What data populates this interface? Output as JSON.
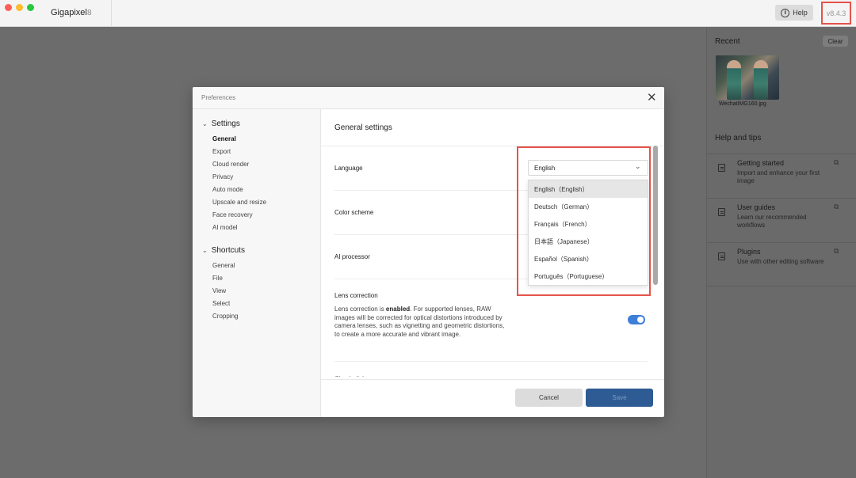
{
  "app": {
    "name": "Gigapixel",
    "version_short": "8",
    "help_label": "Help",
    "version_full": "v8.4.3"
  },
  "right_panel": {
    "recent_label": "Recent",
    "clear_label": "Clear",
    "recent_file": "WechatIMG160.jpg",
    "help_title": "Help and tips",
    "tips": [
      {
        "title": "Getting started",
        "desc": "Import and enhance your first image"
      },
      {
        "title": "User guides",
        "desc": "Learn our recommended workflows"
      },
      {
        "title": "Plugins",
        "desc": "Use with other editing software"
      }
    ]
  },
  "dialog": {
    "title": "Preferences",
    "close": "✕",
    "settings_section": "Settings",
    "settings_items": [
      "General",
      "Export",
      "Cloud render",
      "Privacy",
      "Auto mode",
      "Upscale and resize",
      "Face recovery",
      "AI model"
    ],
    "shortcuts_section": "Shortcuts",
    "shortcuts_items": [
      "General",
      "File",
      "View",
      "Select",
      "Cropping"
    ],
    "main_title": "General settings",
    "language_label": "Language",
    "color_scheme_label": "Color scheme",
    "ai_processor_label": "AI processor",
    "lens_title": "Lens correction",
    "lens_pre": "Lens correction is ",
    "lens_bold": "enabled",
    "lens_post": ". For supported lenses, RAW images will be corrected for optical distortions introduced by camera lenses, such as vignetting and geometric distortions, to create a more accurate and vibrant image.",
    "lens_enabled": true,
    "partial_label": "Check disk space",
    "cancel_label": "Cancel",
    "save_label": "Save"
  },
  "language_select": {
    "value": "English",
    "options": [
      "English（English）",
      "Deutsch（German）",
      "Français（French）",
      "日本語（Japanese）",
      "Español（Spanish）",
      "Português（Portuguese）"
    ],
    "selected_index": 0
  },
  "colors": {
    "accent": "#3d7ed8",
    "save_button": "#2e5b93",
    "highlight": "#e5534b"
  }
}
